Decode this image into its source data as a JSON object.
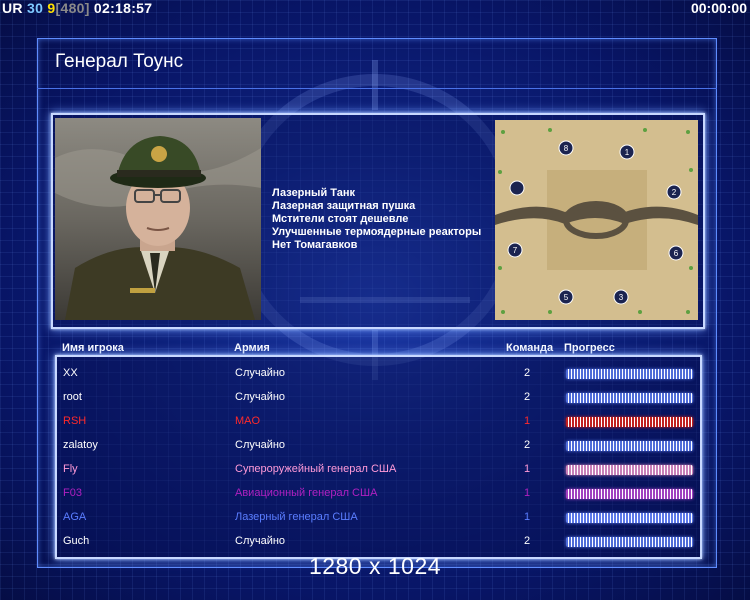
{
  "hud": {
    "ur": "UR",
    "num1": "30",
    "num2": "9",
    "bracket": "[480]",
    "clock": "02:18:57",
    "timer": "00:00:00"
  },
  "general": {
    "title": "Генерал Тоунс",
    "perks": [
      "Лазерный Танк",
      "Лазерная защитная пушка",
      "Мстители стоят дешевле",
      "Улучшенные термоядерные реакторы",
      "Нет Томагавков"
    ]
  },
  "map": {
    "start_positions": [
      "8",
      "1",
      "",
      "2",
      "7",
      "6",
      "5",
      "3"
    ]
  },
  "table": {
    "headers": {
      "player": "Имя игрока",
      "army": "Армия",
      "team": "Команда",
      "progress": "Прогресс"
    },
    "rows": [
      {
        "name": "XX",
        "army": "Случайно",
        "team": "2",
        "color": "#ffffff",
        "bar": "#4f6cd8",
        "progress": 1.0
      },
      {
        "name": "root",
        "army": "Случайно",
        "team": "2",
        "color": "#ffffff",
        "bar": "#4f6cd8",
        "progress": 1.0
      },
      {
        "name": "RSH",
        "army": "MAO",
        "team": "1",
        "color": "#ff2a2a",
        "bar": "#c02020",
        "progress": 1.0
      },
      {
        "name": "zalatoy",
        "army": "Случайно",
        "team": "2",
        "color": "#ffffff",
        "bar": "#4f6cd8",
        "progress": 1.0
      },
      {
        "name": "Fly",
        "army": "Супероружейный генерал США",
        "team": "1",
        "color": "#ff9ad8",
        "bar": "#c880b8",
        "progress": 1.0
      },
      {
        "name": "F03",
        "army": "Авиационный генерал США",
        "team": "1",
        "color": "#b020c0",
        "bar": "#a040c0",
        "progress": 1.0
      },
      {
        "name": "AGA",
        "army": "Лазерный генерал США",
        "team": "1",
        "color": "#5a7dff",
        "bar": "#5b78e8",
        "progress": 1.0
      },
      {
        "name": "Guch",
        "army": "Случайно",
        "team": "2",
        "color": "#ffffff",
        "bar": "#4f6cd8",
        "progress": 1.0
      }
    ]
  },
  "resolution": "1280 x 1024"
}
